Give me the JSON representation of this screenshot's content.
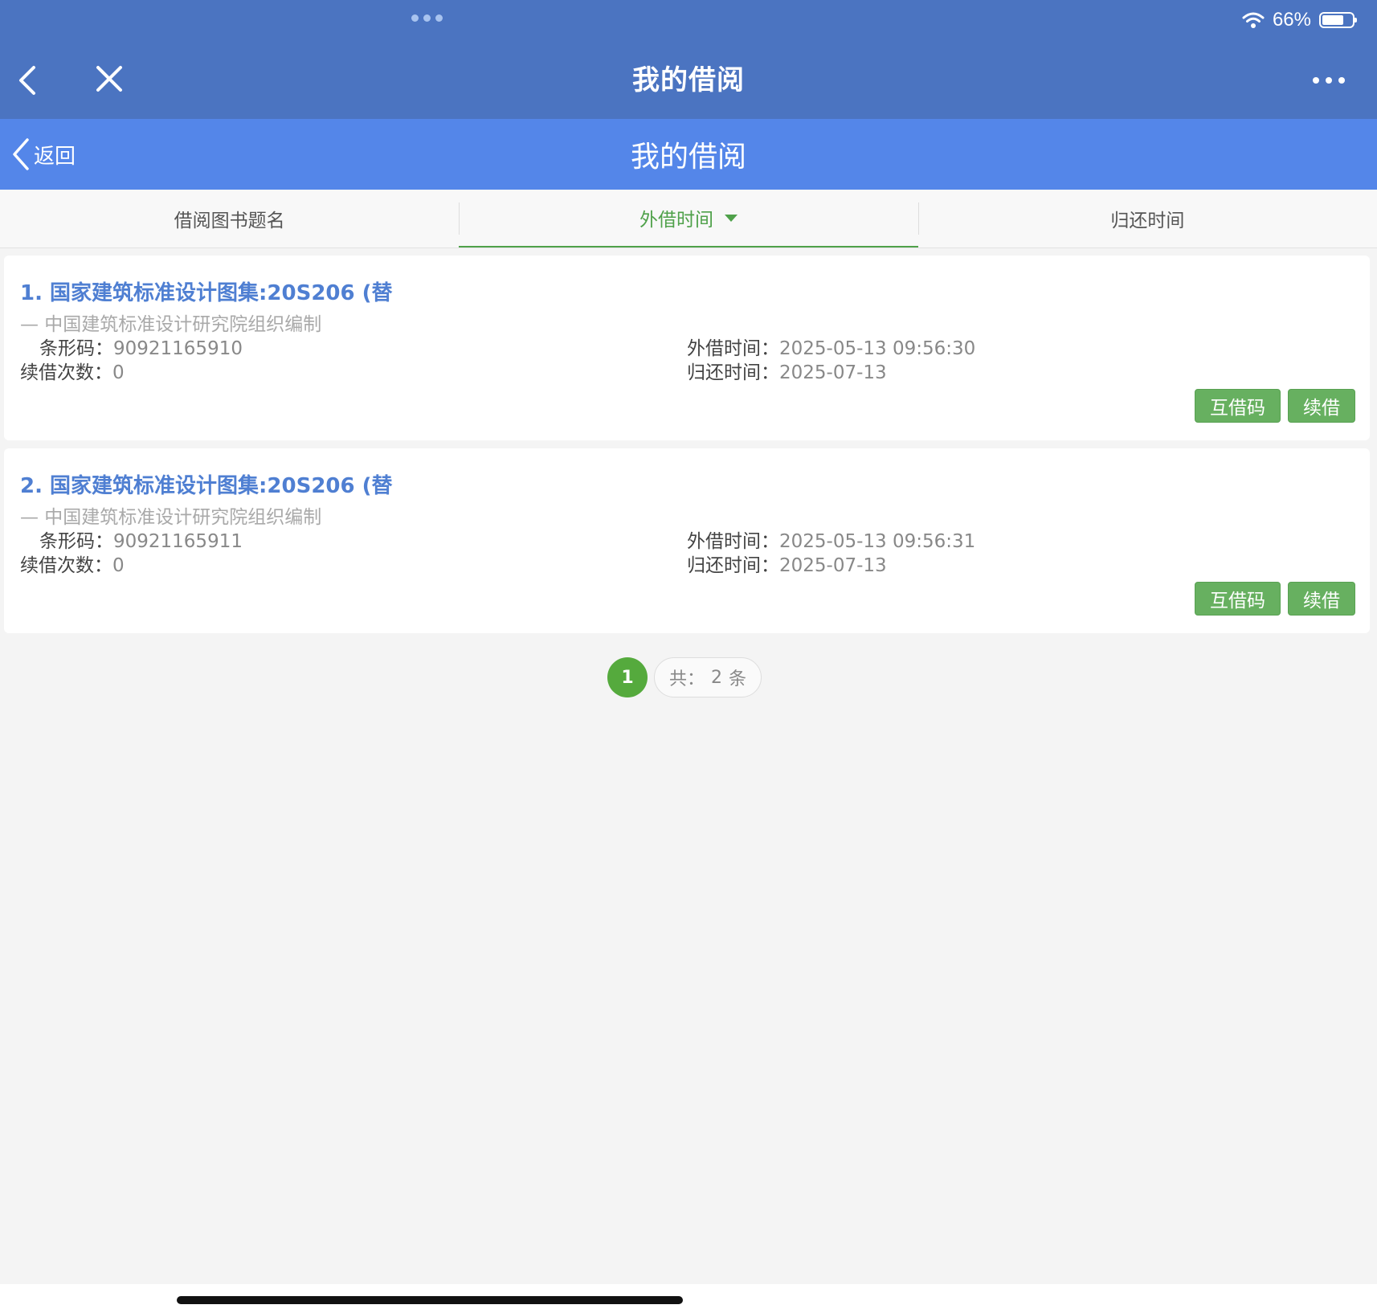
{
  "status_bar": {
    "battery": "66%"
  },
  "nav": {
    "title": "我的借阅"
  },
  "app_header": {
    "back_label": "返回",
    "title": "我的借阅"
  },
  "tabs": [
    {
      "label": "借阅图书题名"
    },
    {
      "label": "外借时间"
    },
    {
      "label": "归还时间"
    }
  ],
  "labels": {
    "barcode": "条形码：",
    "renew_count": "续借次数：",
    "loan_time": "外借时间：",
    "return_time": "归还时间："
  },
  "records": [
    {
      "title": "1. 国家建筑标准设计图集:20S206 (替",
      "author": "— 中国建筑标准设计研究院组织编制",
      "barcode": "90921165910",
      "renew_count": "0",
      "loan_time": "2025-05-13 09:56:30",
      "return_time": "2025-07-13",
      "interlibrary_button": "互借码",
      "renew_button": "续借"
    },
    {
      "title": "2. 国家建筑标准设计图集:20S206 (替",
      "author": "— 中国建筑标准设计研究院组织编制",
      "barcode": "90921165911",
      "renew_count": "0",
      "loan_time": "2025-05-13 09:56:31",
      "return_time": "2025-07-13",
      "interlibrary_button": "互借码",
      "renew_button": "续借"
    }
  ],
  "pagination": {
    "current_page": "1",
    "total_prefix": "共：",
    "total_count": "2",
    "total_suffix": "条"
  },
  "colors": {
    "nav_bg": "#4b74c1",
    "header_bg": "#5486e9",
    "accent_green": "#55aa3d",
    "title_blue": "#4f7fd2"
  }
}
